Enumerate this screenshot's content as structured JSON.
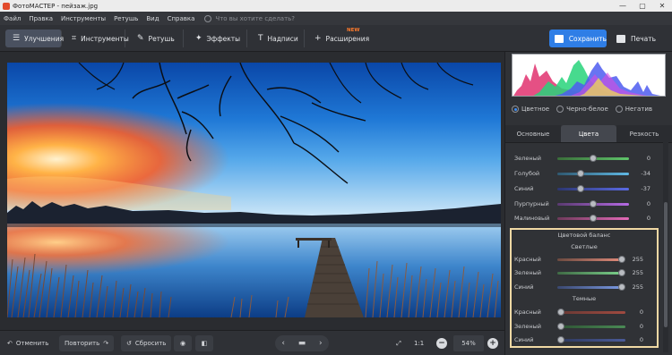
{
  "window": {
    "title": "ФотоМАСТЕР - пейзаж.jpg",
    "controls": [
      "—",
      "▢",
      "✕"
    ]
  },
  "menu": {
    "items": [
      "Файл",
      "Правка",
      "Инструменты",
      "Ретушь",
      "Вид",
      "Справка"
    ],
    "search_placeholder": "Что вы хотите сделать?"
  },
  "toolbar": {
    "tabs": [
      {
        "label": "Улучшения",
        "icon": "sliders-icon",
        "active": true
      },
      {
        "label": "Инструменты",
        "icon": "crop-icon",
        "active": false
      },
      {
        "label": "Ретушь",
        "icon": "brush-icon",
        "active": false
      },
      {
        "label": "Эффекты",
        "icon": "magic-wand-icon",
        "active": false
      },
      {
        "label": "Надписи",
        "icon": "text-icon",
        "active": false
      },
      {
        "label": "Расширения",
        "icon": "plus-icon",
        "active": false
      }
    ],
    "new_badge": "NEW",
    "save_label": "Сохранить",
    "print_label": "Печать"
  },
  "bottom": {
    "undo_label": "Отменить",
    "redo_label": "Повторить",
    "reset_label": "Сбросить",
    "ratio_label": "1:1",
    "zoom_value": "54%"
  },
  "panel": {
    "modes": [
      {
        "label": "Цветное",
        "selected": true
      },
      {
        "label": "Черно-белое",
        "selected": false
      },
      {
        "label": "Негатив",
        "selected": false
      }
    ],
    "subtabs": [
      {
        "label": "Основные",
        "active": false
      },
      {
        "label": "Цвета",
        "active": true
      },
      {
        "label": "Резкость",
        "active": false
      }
    ],
    "color_sliders": [
      {
        "label": "Зеленый",
        "value": "0",
        "level": 0.5,
        "gradient": "#3a6e3a,#5fc56a"
      },
      {
        "label": "Голубой",
        "value": "-34",
        "level": 0.33,
        "gradient": "#2f5870,#5fb8e4"
      },
      {
        "label": "Синий",
        "value": "-37",
        "level": 0.32,
        "gradient": "#2c3670,#5a6ae4"
      },
      {
        "label": "Пурпурный",
        "value": "0",
        "level": 0.5,
        "gradient": "#5a3a70,#b56ae4"
      },
      {
        "label": "Малиновый",
        "value": "0",
        "level": 0.5,
        "gradient": "#6e3a5a,#e46ab8"
      }
    ],
    "balance": {
      "title": "Цветовой баланс",
      "light_title": "Светлые",
      "dark_title": "Темные",
      "light": [
        {
          "label": "Красный",
          "value": "255",
          "level": 1.0,
          "gradient": "#6b4a40,#e08a7a"
        },
        {
          "label": "Зеленый",
          "value": "255",
          "level": 1.0,
          "gradient": "#3f6a45,#7ad08a"
        },
        {
          "label": "Синий",
          "value": "255",
          "level": 1.0,
          "gradient": "#3a4870,#7a98e0"
        }
      ],
      "dark": [
        {
          "label": "Красный",
          "value": "0",
          "level": 0.0,
          "gradient": "#6b3a35,#a04a40"
        },
        {
          "label": "Зеленый",
          "value": "0",
          "level": 0.0,
          "gradient": "#2f5535,#4a8a55"
        },
        {
          "label": "Синий",
          "value": "0",
          "level": 0.0,
          "gradient": "#2f3a60,#4a5a98"
        }
      ]
    }
  }
}
